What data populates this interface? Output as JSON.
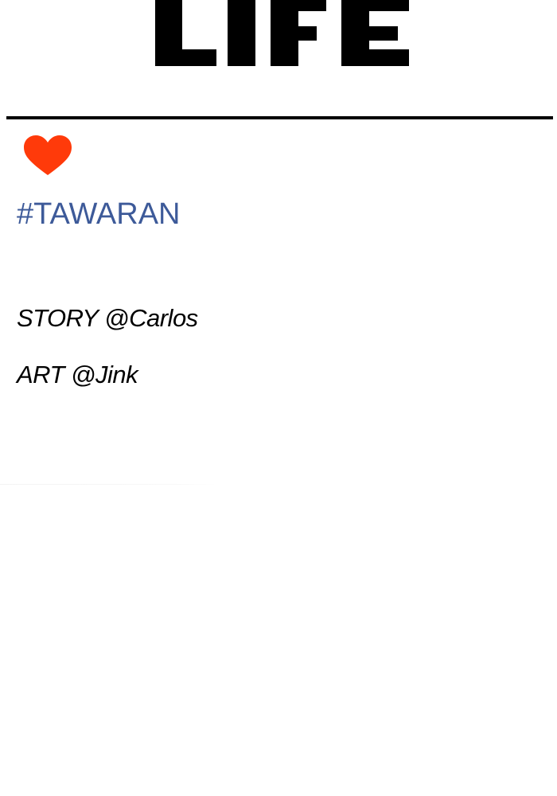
{
  "header": {
    "logo_text": "LIFE"
  },
  "tag": {
    "label": "#TAWARAN",
    "color": "#3d5a99"
  },
  "heart": {
    "icon": "heart-icon",
    "color": "#ff3a0a"
  },
  "credits": {
    "story": "STORY @Carlos",
    "art": "ART @Jink"
  }
}
